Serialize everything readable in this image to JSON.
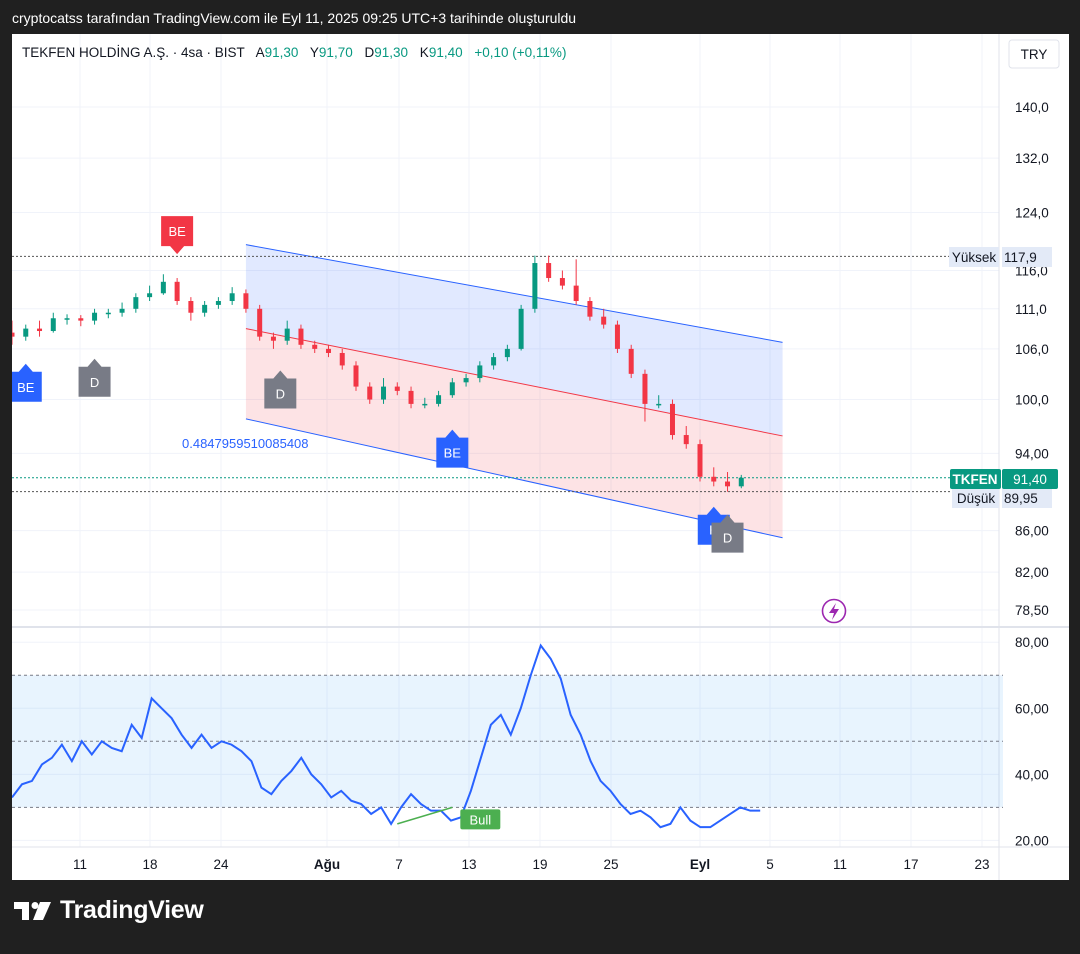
{
  "header": {
    "snapshot_caption": "cryptocatss tarafından TradingView.com ile Eyl 11, 2025 09:25 UTC+3 tarihinde oluşturuldu"
  },
  "legend": {
    "symbol": "TEKFEN HOLDİNG A.Ş. · 4sa · BIST",
    "open_label": "A",
    "open": "91,30",
    "high_label": "Y",
    "high": "91,70",
    "low_label": "D",
    "low": "91,30",
    "close_label": "K",
    "close": "91,40",
    "change": "+0,10 (+0,11%)"
  },
  "currency_button": "TRY",
  "brand": {
    "logo_text": "TradingView"
  },
  "colors": {
    "up": "#089981",
    "down": "#f23645",
    "channel_blue": "#2962ff",
    "rsi_line": "#2962ff",
    "accent": "#2962ff"
  },
  "chart_data": [
    {
      "type": "candlestick",
      "title": "",
      "y_axis": {
        "scale": "log",
        "ticks": [
          "140,0",
          "132,0",
          "124,0",
          "116,0",
          "111,0",
          "106,0",
          "100,0",
          "94,00",
          "86,00",
          "82,00",
          "78,50"
        ]
      },
      "x_axis": {
        "ticks": [
          "11",
          "18",
          "24",
          "Ağu",
          "7",
          "13",
          "19",
          "25",
          "Eyl",
          "5",
          "11",
          "17",
          "23"
        ]
      },
      "close_path": [
        {
          "x": 0,
          "y": 107.5
        },
        {
          "x": 4,
          "y": 108.5
        },
        {
          "x": 8,
          "y": 108.2
        },
        {
          "x": 12,
          "y": 109.8
        },
        {
          "x": 16,
          "y": 109.8
        },
        {
          "x": 20,
          "y": 109.5
        },
        {
          "x": 24,
          "y": 110.5
        },
        {
          "x": 28,
          "y": 110.5
        },
        {
          "x": 32,
          "y": 111.0
        },
        {
          "x": 36,
          "y": 112.5
        },
        {
          "x": 40,
          "y": 113.0
        },
        {
          "x": 44,
          "y": 114.5
        },
        {
          "x": 48,
          "y": 112.0
        },
        {
          "x": 52,
          "y": 110.5
        },
        {
          "x": 56,
          "y": 111.5
        },
        {
          "x": 60,
          "y": 112.0
        },
        {
          "x": 64,
          "y": 113.0
        },
        {
          "x": 68,
          "y": 111.0
        },
        {
          "x": 72,
          "y": 107.5
        },
        {
          "x": 76,
          "y": 107.0
        },
        {
          "x": 80,
          "y": 108.5
        },
        {
          "x": 84,
          "y": 106.5
        },
        {
          "x": 88,
          "y": 106.0
        },
        {
          "x": 92,
          "y": 105.5
        },
        {
          "x": 96,
          "y": 104.0
        },
        {
          "x": 100,
          "y": 101.5
        },
        {
          "x": 104,
          "y": 100.0
        },
        {
          "x": 108,
          "y": 101.5
        },
        {
          "x": 112,
          "y": 101.0
        },
        {
          "x": 116,
          "y": 99.5
        },
        {
          "x": 120,
          "y": 99.5
        },
        {
          "x": 124,
          "y": 100.5
        },
        {
          "x": 128,
          "y": 102.0
        },
        {
          "x": 132,
          "y": 102.5
        },
        {
          "x": 136,
          "y": 104.0
        },
        {
          "x": 140,
          "y": 105.0
        },
        {
          "x": 144,
          "y": 106.0
        },
        {
          "x": 148,
          "y": 111.0
        },
        {
          "x": 152,
          "y": 117.0
        },
        {
          "x": 156,
          "y": 115.0
        },
        {
          "x": 160,
          "y": 114.0
        },
        {
          "x": 164,
          "y": 112.0
        },
        {
          "x": 168,
          "y": 110.0
        },
        {
          "x": 172,
          "y": 109.0
        },
        {
          "x": 176,
          "y": 106.0
        },
        {
          "x": 180,
          "y": 103.0
        },
        {
          "x": 184,
          "y": 99.5
        },
        {
          "x": 188,
          "y": 99.5
        },
        {
          "x": 192,
          "y": 96.0
        },
        {
          "x": 196,
          "y": 95.0
        },
        {
          "x": 200,
          "y": 91.5
        },
        {
          "x": 204,
          "y": 91.0
        },
        {
          "x": 208,
          "y": 90.5
        },
        {
          "x": 212,
          "y": 91.4
        }
      ],
      "candles": [
        {
          "o": 108,
          "h": 109.5,
          "l": 106.5,
          "c": 107.5
        },
        {
          "o": 107.5,
          "h": 109,
          "l": 107,
          "c": 108.5
        },
        {
          "o": 108.5,
          "h": 109.5,
          "l": 107.5,
          "c": 108.2
        },
        {
          "o": 108.2,
          "h": 110.5,
          "l": 108,
          "c": 109.8
        },
        {
          "o": 109.8,
          "h": 110.3,
          "l": 109,
          "c": 109.8
        },
        {
          "o": 109.8,
          "h": 110.2,
          "l": 108.8,
          "c": 109.5
        },
        {
          "o": 109.5,
          "h": 111,
          "l": 109,
          "c": 110.5
        },
        {
          "o": 110.5,
          "h": 111,
          "l": 109.8,
          "c": 110.5
        },
        {
          "o": 110.5,
          "h": 111.8,
          "l": 110,
          "c": 111
        },
        {
          "o": 111,
          "h": 113,
          "l": 110.5,
          "c": 112.5
        },
        {
          "o": 112.5,
          "h": 114,
          "l": 112,
          "c": 113
        },
        {
          "o": 113,
          "h": 115.5,
          "l": 112.8,
          "c": 114.5
        },
        {
          "o": 114.5,
          "h": 115,
          "l": 111.5,
          "c": 112
        },
        {
          "o": 112,
          "h": 112.5,
          "l": 109.5,
          "c": 110.5
        },
        {
          "o": 110.5,
          "h": 112,
          "l": 110,
          "c": 111.5
        },
        {
          "o": 111.5,
          "h": 112.5,
          "l": 111,
          "c": 112
        },
        {
          "o": 112,
          "h": 113.8,
          "l": 111.5,
          "c": 113
        },
        {
          "o": 113,
          "h": 113.5,
          "l": 110.5,
          "c": 111
        },
        {
          "o": 111,
          "h": 111.5,
          "l": 107,
          "c": 107.5
        },
        {
          "o": 107.5,
          "h": 108,
          "l": 106,
          "c": 107
        },
        {
          "o": 107,
          "h": 109.5,
          "l": 106.5,
          "c": 108.5
        },
        {
          "o": 108.5,
          "h": 109,
          "l": 106,
          "c": 106.5
        },
        {
          "o": 106.5,
          "h": 107,
          "l": 105.5,
          "c": 106
        },
        {
          "o": 106,
          "h": 106.5,
          "l": 105,
          "c": 105.5
        },
        {
          "o": 105.5,
          "h": 106,
          "l": 103.5,
          "c": 104
        },
        {
          "o": 104,
          "h": 104.5,
          "l": 101,
          "c": 101.5
        },
        {
          "o": 101.5,
          "h": 102,
          "l": 99.5,
          "c": 100
        },
        {
          "o": 100,
          "h": 102.5,
          "l": 99.5,
          "c": 101.5
        },
        {
          "o": 101.5,
          "h": 102,
          "l": 100.5,
          "c": 101
        },
        {
          "o": 101,
          "h": 101.5,
          "l": 99,
          "c": 99.5
        },
        {
          "o": 99.5,
          "h": 100.2,
          "l": 99,
          "c": 99.5
        },
        {
          "o": 99.5,
          "h": 101,
          "l": 99.2,
          "c": 100.5
        },
        {
          "o": 100.5,
          "h": 102.5,
          "l": 100.2,
          "c": 102
        },
        {
          "o": 102,
          "h": 103,
          "l": 101.5,
          "c": 102.5
        },
        {
          "o": 102.5,
          "h": 104.5,
          "l": 102,
          "c": 104
        },
        {
          "o": 104,
          "h": 105.5,
          "l": 103.5,
          "c": 105
        },
        {
          "o": 105,
          "h": 106.5,
          "l": 104.5,
          "c": 106
        },
        {
          "o": 106,
          "h": 111.5,
          "l": 105.8,
          "c": 111
        },
        {
          "o": 111,
          "h": 118,
          "l": 110.5,
          "c": 117
        },
        {
          "o": 117,
          "h": 118,
          "l": 114.5,
          "c": 115
        },
        {
          "o": 115,
          "h": 116,
          "l": 113.5,
          "c": 114
        },
        {
          "o": 114,
          "h": 117.5,
          "l": 111.5,
          "c": 112
        },
        {
          "o": 112,
          "h": 112.5,
          "l": 109.5,
          "c": 110
        },
        {
          "o": 110,
          "h": 111,
          "l": 108.5,
          "c": 109
        },
        {
          "o": 109,
          "h": 109.5,
          "l": 105.5,
          "c": 106
        },
        {
          "o": 106,
          "h": 106.5,
          "l": 102.5,
          "c": 103
        },
        {
          "o": 103,
          "h": 103.5,
          "l": 97.5,
          "c": 99.5
        },
        {
          "o": 99.5,
          "h": 100.5,
          "l": 99,
          "c": 99.5
        },
        {
          "o": 99.5,
          "h": 100,
          "l": 95.5,
          "c": 96
        },
        {
          "o": 96,
          "h": 97,
          "l": 94.5,
          "c": 95
        },
        {
          "o": 95,
          "h": 95.5,
          "l": 91,
          "c": 91.5
        },
        {
          "o": 91.5,
          "h": 92.5,
          "l": 90.5,
          "c": 91
        },
        {
          "o": 91,
          "h": 92,
          "l": 89.95,
          "c": 90.5
        },
        {
          "o": 90.5,
          "h": 91.7,
          "l": 90.3,
          "c": 91.4
        }
      ],
      "channel": {
        "upper": {
          "x1": 68,
          "y1": 119.5,
          "x2": 224,
          "y2": 106.8
        },
        "lower": {
          "x1": 68,
          "y1": 97.8,
          "x2": 224,
          "y2": 85.3
        },
        "mid": {
          "x1": 68,
          "y1": 108.5,
          "x2": 224,
          "y2": 95.9
        },
        "label": "0.4847959510085408"
      },
      "reference_lines": [
        {
          "label": "Yüksek",
          "value": 117.9,
          "price_label": "117,9"
        },
        {
          "label": "Düşük",
          "value": 89.95,
          "price_label": "89,95"
        }
      ],
      "last_price": {
        "symbol": "TKFEN",
        "value": 91.4,
        "price_label": "91,40"
      },
      "markers": [
        {
          "text": "BE",
          "position": "below",
          "x": 4,
          "price": 104.2,
          "color": "#2962ff"
        },
        {
          "text": "D",
          "position": "below",
          "x": 24,
          "price": 104.8,
          "color": "#787b86"
        },
        {
          "text": "BE",
          "position": "above",
          "x": 48,
          "price": 118.2,
          "color": "#f23645"
        },
        {
          "text": "D",
          "position": "below",
          "x": 78,
          "price": 103.4,
          "color": "#787b86"
        },
        {
          "text": "BE",
          "position": "below",
          "x": 128,
          "price": 96.6,
          "color": "#2962ff"
        },
        {
          "text": "H",
          "position": "below",
          "x": 204,
          "price": 88.4,
          "color": "#2962ff"
        },
        {
          "text": "D",
          "position": "below",
          "x": 208,
          "price": 87.6,
          "color": "#787b86"
        }
      ]
    },
    {
      "type": "line",
      "title": "",
      "y_axis": {
        "range": [
          18,
          84
        ],
        "ticks": [
          "80,00",
          "60,00",
          "40,00",
          "20,00"
        ]
      },
      "band": {
        "upper": 70,
        "middle": 50,
        "lower": 30
      },
      "series": [
        {
          "values": [
            33,
            37,
            38,
            43,
            45,
            49,
            44,
            50,
            46,
            50,
            48,
            47,
            55,
            51,
            63,
            60,
            57,
            52,
            48,
            52,
            48,
            50,
            49,
            47,
            44,
            36,
            34,
            38,
            41,
            45,
            40,
            37,
            33,
            35,
            32,
            31,
            28,
            30,
            25,
            30,
            34,
            31,
            29,
            29,
            26,
            27,
            35,
            45,
            55,
            58,
            52,
            60,
            70,
            79,
            75,
            69,
            58,
            52,
            44,
            38,
            35,
            31,
            28,
            29,
            27,
            24,
            25,
            30,
            26,
            24,
            24,
            26,
            28,
            30,
            29,
            29
          ],
          "x_step": 2.9
        }
      ],
      "divergence": {
        "label": "Bull",
        "x1": 112,
        "y1": 25,
        "x2": 128,
        "y2": 30
      }
    }
  ]
}
